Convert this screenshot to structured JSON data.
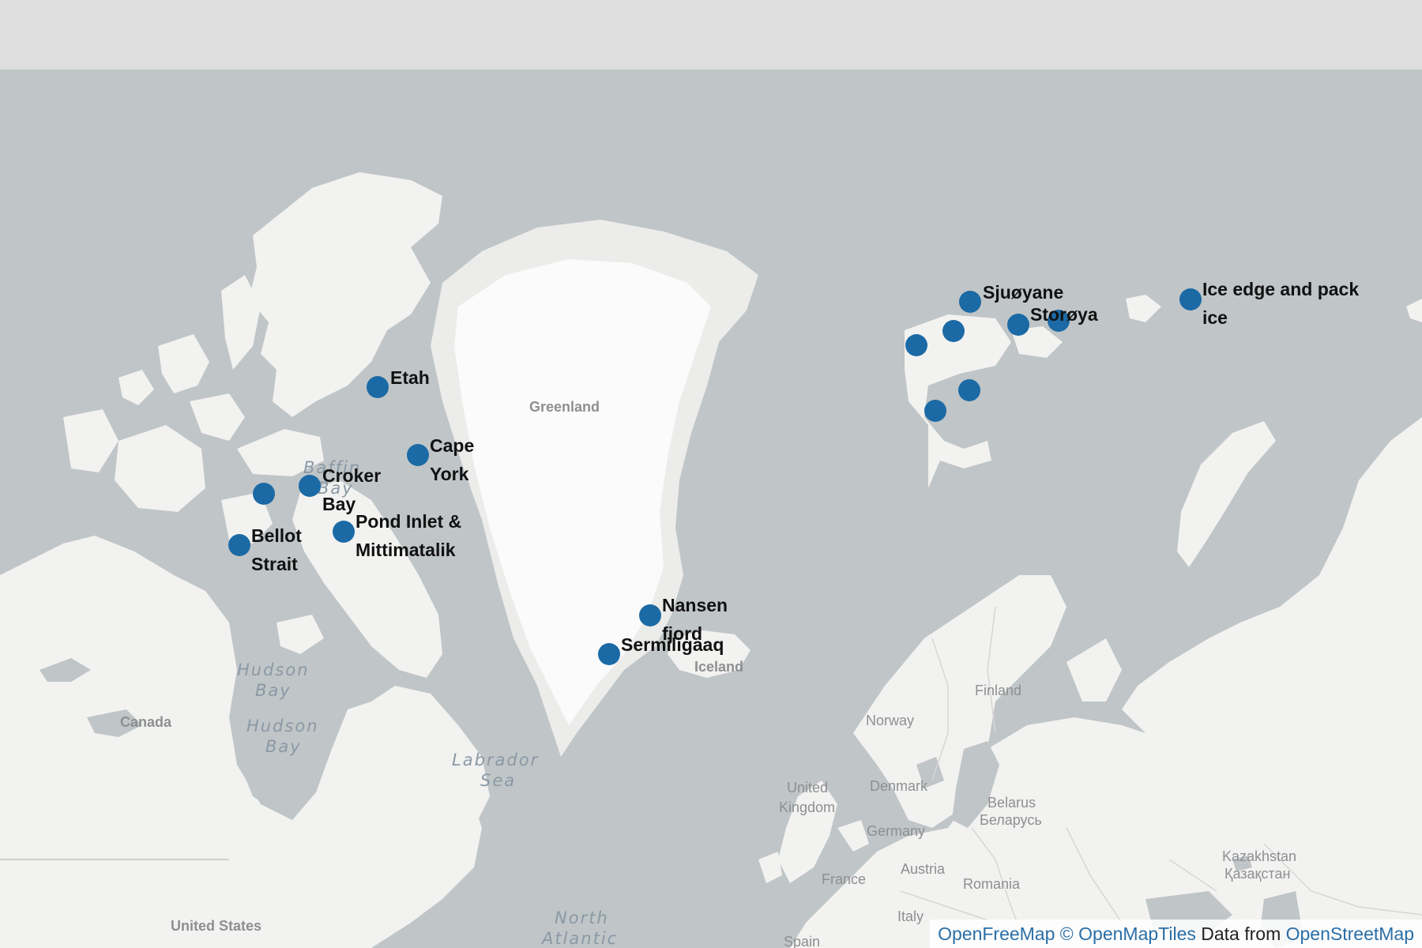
{
  "map": {
    "colors": {
      "water": "#c0c5c7",
      "land": "#f2f2f0",
      "ice": "#fbfbfb",
      "marker": "#1b6aa5",
      "toolbar": "#dedede"
    },
    "place_labels": {
      "greenland": "Greenland",
      "canada": "Canada",
      "united_states": "United States",
      "iceland": "Iceland",
      "norway": "Norway",
      "finland": "Finland",
      "denmark": "Denmark",
      "united_kingdom_1": "United",
      "united_kingdom_2": "Kingdom",
      "germany": "Germany",
      "belarus_1": "Belarus",
      "belarus_2": "Беларусь",
      "france": "France",
      "austria": "Austria",
      "romania": "Romania",
      "italy": "Italy",
      "spain": "Spain",
      "kazakhstan_1": "Kazakhstan",
      "kazakhstan_2": "Қазақстан"
    },
    "water_labels": {
      "baffin_bay_1": "Baffin",
      "baffin_bay_2": "Bay",
      "hudson_bay_1": "Hudson",
      "hudson_bay_2": "Bay",
      "labrador_sea_1": "Labrador",
      "labrador_sea_2": "Sea",
      "north_atlantic_1": "North",
      "north_atlantic_2": "Atlantic"
    },
    "markers": [
      {
        "id": "etah",
        "label": [
          "Etah"
        ]
      },
      {
        "id": "cape-york",
        "label": [
          "Cape",
          "York"
        ]
      },
      {
        "id": "croker-bay",
        "label": [
          "Croker",
          "Bay"
        ]
      },
      {
        "id": "unnamed-west",
        "label": []
      },
      {
        "id": "bellot-strait",
        "label": [
          "Bellot",
          "Strait"
        ]
      },
      {
        "id": "pond-inlet",
        "label": [
          "Pond Inlet &",
          "Mittimatalik"
        ]
      },
      {
        "id": "nansen-fjord",
        "label": [
          "Nansen",
          "fjord"
        ]
      },
      {
        "id": "sermiligaaq",
        "label": [
          "Sermiligaaq"
        ]
      },
      {
        "id": "sjuoyane",
        "label": [
          "Sjuøyane"
        ]
      },
      {
        "id": "storoya",
        "label": [
          "Storøya"
        ]
      },
      {
        "id": "svalbard-a",
        "label": []
      },
      {
        "id": "svalbard-b",
        "label": []
      },
      {
        "id": "svalbard-c",
        "label": []
      },
      {
        "id": "svalbard-d",
        "label": []
      },
      {
        "id": "svalbard-e",
        "label": []
      },
      {
        "id": "ice-edge",
        "label": [
          "Ice edge and pack",
          "ice"
        ]
      }
    ]
  },
  "attribution": {
    "openfreemap": "OpenFreeMap",
    "copyright": "©",
    "openmaptiles": "OpenMapTiles",
    "data_from": "Data from",
    "openstreetmap": "OpenStreetMap"
  }
}
